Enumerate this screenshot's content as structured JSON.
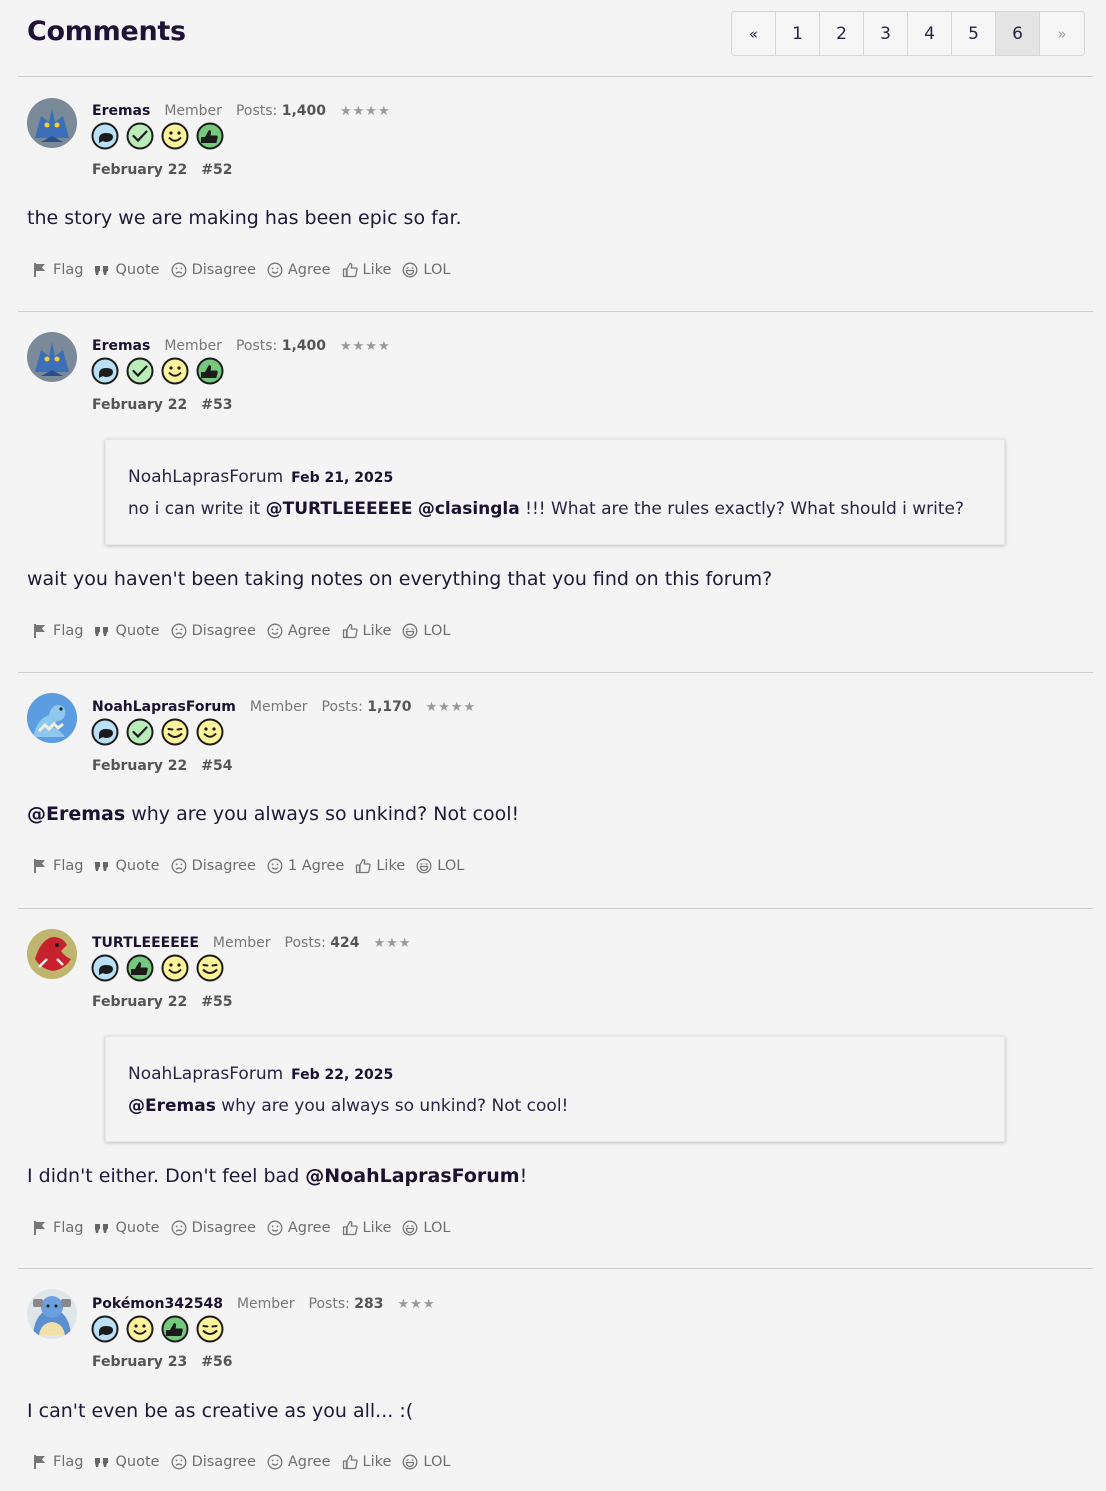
{
  "header": {
    "title": "Comments",
    "pagination": {
      "first": "«",
      "pages": [
        "1",
        "2",
        "3",
        "4",
        "5",
        "6"
      ],
      "current": "6",
      "next": "»"
    }
  },
  "actions": {
    "flag": "Flag",
    "quote": "Quote",
    "disagree": "Disagree",
    "agree": "Agree",
    "agree_count": "1 Agree",
    "like": "Like",
    "lol": "LOL"
  },
  "posts": [
    {
      "username": "Eremas",
      "role": "Member",
      "posts_label": "Posts:",
      "posts": "1,400",
      "stars": "★★★★",
      "date": "February 22",
      "number": "#52",
      "badges": [
        "speech-5",
        "check-3",
        "grin-3",
        "thumb-3"
      ],
      "content": "the story we are making has been epic so far."
    },
    {
      "username": "Eremas",
      "role": "Member",
      "posts_label": "Posts:",
      "posts": "1,400",
      "stars": "★★★★",
      "date": "February 22",
      "number": "#53",
      "badges": [
        "speech-5",
        "check-3",
        "grin-3",
        "thumb-3"
      ],
      "quote": {
        "author": "NoahLaprasForum",
        "date": "Feb 21, 2025",
        "text_before": "no i can write it ",
        "mention1": "@TURTLEEEEEE",
        "mention2": "@clasingla",
        "text_after": " !!! What are the rules exactly? What should i write?"
      },
      "content": "wait you haven't been taking notes on everything that you find on this forum?"
    },
    {
      "username": "NoahLaprasForum",
      "role": "Member",
      "posts_label": "Posts:",
      "posts": "1,170",
      "stars": "★★★★",
      "date": "February 22",
      "number": "#54",
      "badges": [
        "speech-5",
        "check-3",
        "wink-3",
        "grin-3"
      ],
      "content_mention": "@Eremas",
      "content": " why are you always so unkind? Not cool!"
    },
    {
      "username": "TURTLEEEEEE",
      "role": "Member",
      "posts_label": "Posts:",
      "posts": "424",
      "stars": "★★★",
      "date": "February 22",
      "number": "#55",
      "badges": [
        "speech-3",
        "thumb-2",
        "grin-2",
        "wink"
      ],
      "quote": {
        "author": "NoahLaprasForum",
        "date": "Feb 22, 2025",
        "mention": "@Eremas",
        "text": " why are you always so unkind? Not cool!"
      },
      "content": "I didn't either. Don't feel bad ",
      "content_mention": "@NoahLaprasForum",
      "content_end": "!"
    },
    {
      "username": "Pokémon342548",
      "role": "Member",
      "posts_label": "Posts:",
      "posts": "283",
      "stars": "★★★",
      "date": "February 23",
      "number": "#56",
      "badges": [
        "speech-3",
        "grin-2",
        "thumb-2",
        "wink"
      ],
      "content": "I can't even be as creative as you all... :("
    }
  ]
}
